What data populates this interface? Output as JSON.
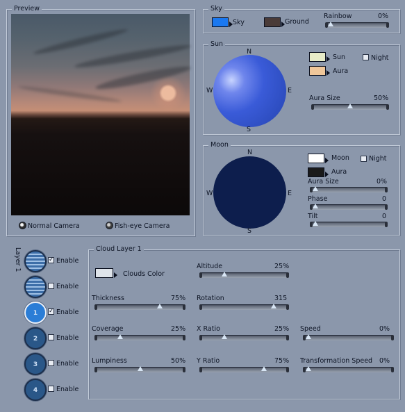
{
  "preview": {
    "title": "Preview",
    "camera_normal": "Normal Camera",
    "camera_fisheye": "Fish-eye Camera",
    "selected_camera": "Normal Camera"
  },
  "sky": {
    "title": "Sky",
    "sky_label": "Sky",
    "sky_color": "#1a78f0",
    "ground_label": "Ground",
    "ground_color": "#4a3b38",
    "rainbow_label": "Rainbow",
    "rainbow_value": "0%",
    "rainbow_level": 0.0
  },
  "sun": {
    "title": "Sun",
    "compass": {
      "n": "N",
      "s": "S",
      "e": "E",
      "w": "W"
    },
    "sun_label": "Sun",
    "sun_color": "#e8ecc8",
    "aura_label": "Aura",
    "aura_color": "#f0c79a",
    "night_label": "Night",
    "night_checked": false,
    "aura_size_label": "Aura Size",
    "aura_size_value": "50%",
    "aura_size_level": 0.5
  },
  "moon": {
    "title": "Moon",
    "compass": {
      "n": "N",
      "s": "S",
      "e": "E",
      "w": "W"
    },
    "moon_label": "Moon",
    "moon_color": "#ffffff",
    "aura_label": "Aura",
    "aura_color": "#1a1a1a",
    "night_label": "Night",
    "night_checked": false,
    "aura_size_label": "Aura Size",
    "aura_size_value": "0%",
    "aura_size_level": 0.0,
    "phase_label": "Phase",
    "phase_value": "0",
    "phase_level": 0.0,
    "tilt_label": "Tilt",
    "tilt_value": "0",
    "tilt_level": 0.0
  },
  "layers": {
    "title": "Layer 1",
    "items": [
      {
        "icon": "stripes-layer-icon",
        "enable_label": "Enable",
        "checked": true,
        "num": ""
      },
      {
        "icon": "stripes-layer-icon",
        "enable_label": "Enable",
        "checked": false,
        "num": ""
      },
      {
        "icon": "cloud-layer-icon",
        "enable_label": "Enable",
        "checked": true,
        "num": "1"
      },
      {
        "icon": "cloud-layer-icon",
        "enable_label": "Enable",
        "checked": false,
        "num": "2"
      },
      {
        "icon": "cloud-layer-icon",
        "enable_label": "Enable",
        "checked": false,
        "num": "3"
      },
      {
        "icon": "cloud-layer-icon",
        "enable_label": "Enable",
        "checked": false,
        "num": "4"
      }
    ]
  },
  "cloud": {
    "title": "Cloud Layer 1",
    "color_label": "Clouds Color",
    "color": "#dfe4ea",
    "altitude": {
      "label": "Altitude",
      "value": "25%",
      "level": 0.25
    },
    "thickness": {
      "label": "Thickness",
      "value": "75%",
      "level": 0.75
    },
    "rotation": {
      "label": "Rotation",
      "value": "315",
      "level": 0.875
    },
    "coverage": {
      "label": "Coverage",
      "value": "25%",
      "level": 0.25
    },
    "x_ratio": {
      "label": "X Ratio",
      "value": "25%",
      "level": 0.25
    },
    "speed": {
      "label": "Speed",
      "value": "0%",
      "level": 0.0
    },
    "lumpiness": {
      "label": "Lumpiness",
      "value": "50%",
      "level": 0.5
    },
    "y_ratio": {
      "label": "Y Ratio",
      "value": "75%",
      "level": 0.75
    },
    "transformation_speed": {
      "label": "Transformation Speed",
      "value": "0%",
      "level": 0.0
    }
  }
}
